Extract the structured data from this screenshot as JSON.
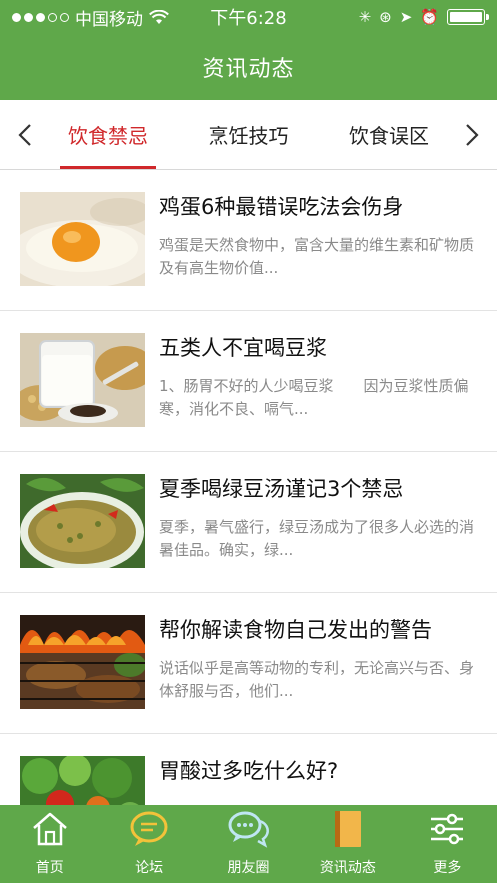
{
  "status_bar": {
    "carrier": "中国移动",
    "time": "下午6:28",
    "signal_bars_filled": 3,
    "signal_bars_total": 5
  },
  "header": {
    "title": "资讯动态"
  },
  "tabs": {
    "prev_icon": "chevron-left-icon",
    "next_icon": "chevron-right-icon",
    "items": [
      {
        "label": "饮食禁忌",
        "active": true
      },
      {
        "label": "烹饪技巧",
        "active": false
      },
      {
        "label": "饮食误区",
        "active": false
      }
    ]
  },
  "news": [
    {
      "title": "鸡蛋6种最错误吃法会伤身",
      "summary": "鸡蛋是天然食物中，富含大量的维生素和矿物质及有高生物价值...",
      "thumb": "egg-photo"
    },
    {
      "title": "五类人不宜喝豆浆",
      "summary": "1、肠胃不好的人少喝豆浆　　因为豆浆性质偏寒，消化不良、嗝气...",
      "thumb": "soymilk-photo"
    },
    {
      "title": "夏季喝绿豆汤谨记3个禁忌",
      "summary": "夏季，暑气盛行，绿豆汤成为了很多人必选的消暑佳品。确实，绿...",
      "thumb": "mungbean-soup-photo"
    },
    {
      "title": "帮你解读食物自己发出的警告",
      "summary": "说话似乎是高等动物的专利，无论高兴与否、身体舒服与否，他们...",
      "thumb": "grill-photo"
    },
    {
      "title": "胃酸过多吃什么好?",
      "summary": "",
      "thumb": "vegetables-photo"
    }
  ],
  "bottom_nav": [
    {
      "label": "首页",
      "icon": "home-icon"
    },
    {
      "label": "论坛",
      "icon": "forum-icon"
    },
    {
      "label": "朋友圈",
      "icon": "chat-bubbles-icon"
    },
    {
      "label": "资讯动态",
      "icon": "book-icon"
    },
    {
      "label": "更多",
      "icon": "sliders-icon"
    }
  ],
  "colors": {
    "brand_green": "#5fa84a",
    "active_tab_red": "#d0282b"
  }
}
